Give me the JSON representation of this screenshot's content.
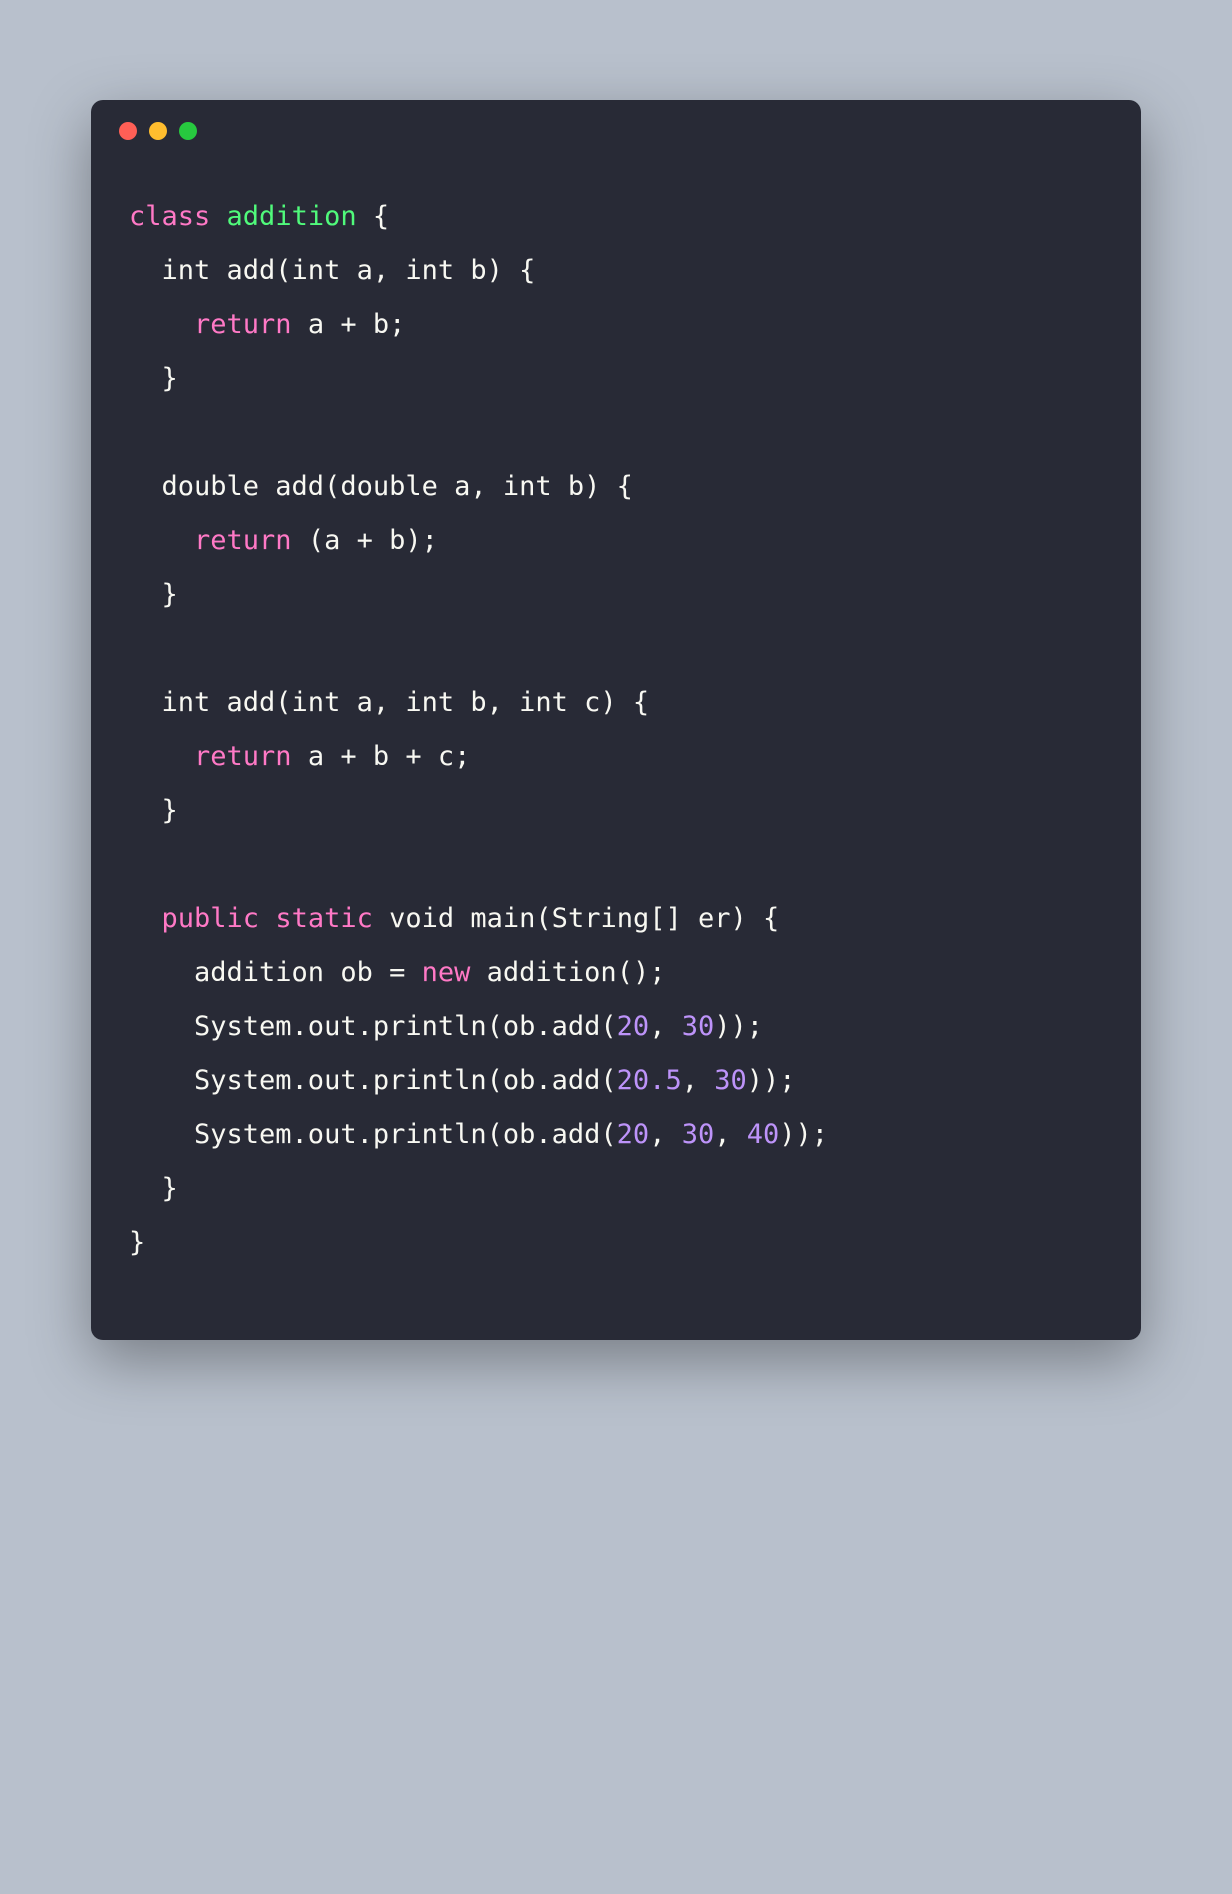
{
  "traffic_lights": {
    "red_color": "#ff5f56",
    "yellow_color": "#ffbd2e",
    "green_color": "#27c93f"
  },
  "code": {
    "line1": {
      "class_kw": "class",
      "class_name": "addition",
      "brace": " {"
    },
    "line2": {
      "sig": "  int add(int a, int b) {"
    },
    "line3": {
      "indent": "    ",
      "return_kw": "return",
      "expr": " a + b;"
    },
    "line4": {
      "text": "  }"
    },
    "line5_blank": "",
    "line6": {
      "sig": "  double add(double a, int b) {"
    },
    "line7": {
      "indent": "    ",
      "return_kw": "return",
      "expr": " (a + b);"
    },
    "line8": {
      "text": "  }"
    },
    "line9_blank": "",
    "line10": {
      "sig": "  int add(int a, int b, int c) {"
    },
    "line11": {
      "indent": "    ",
      "return_kw": "return",
      "expr": " a + b + c;"
    },
    "line12": {
      "text": "  }"
    },
    "line13_blank": "",
    "line14": {
      "indent": "  ",
      "public_kw": "public",
      "space1": " ",
      "static_kw": "static",
      "rest": " void main(String[] er) {"
    },
    "line15": {
      "pre": "    addition ob = ",
      "new_kw": "new",
      "post": " addition();"
    },
    "line16": {
      "pre": "    System.out.println(ob.add(",
      "num1": "20",
      "comma": ", ",
      "num2": "30",
      "post": "));"
    },
    "line17": {
      "pre": "    System.out.println(ob.add(",
      "num1": "20.5",
      "comma": ", ",
      "num2": "30",
      "post": "));"
    },
    "line18": {
      "pre": "    System.out.println(ob.add(",
      "num1": "20",
      "comma1": ", ",
      "num2": "30",
      "comma2": ", ",
      "num3": "40",
      "post": "));"
    },
    "line19": {
      "text": "  }"
    },
    "line20": {
      "text": "}"
    }
  },
  "theme": {
    "background": "#282a36",
    "foreground": "#f8f8f2",
    "pink": "#ff79c6",
    "green": "#50fa7b",
    "purple": "#bd93f9"
  }
}
